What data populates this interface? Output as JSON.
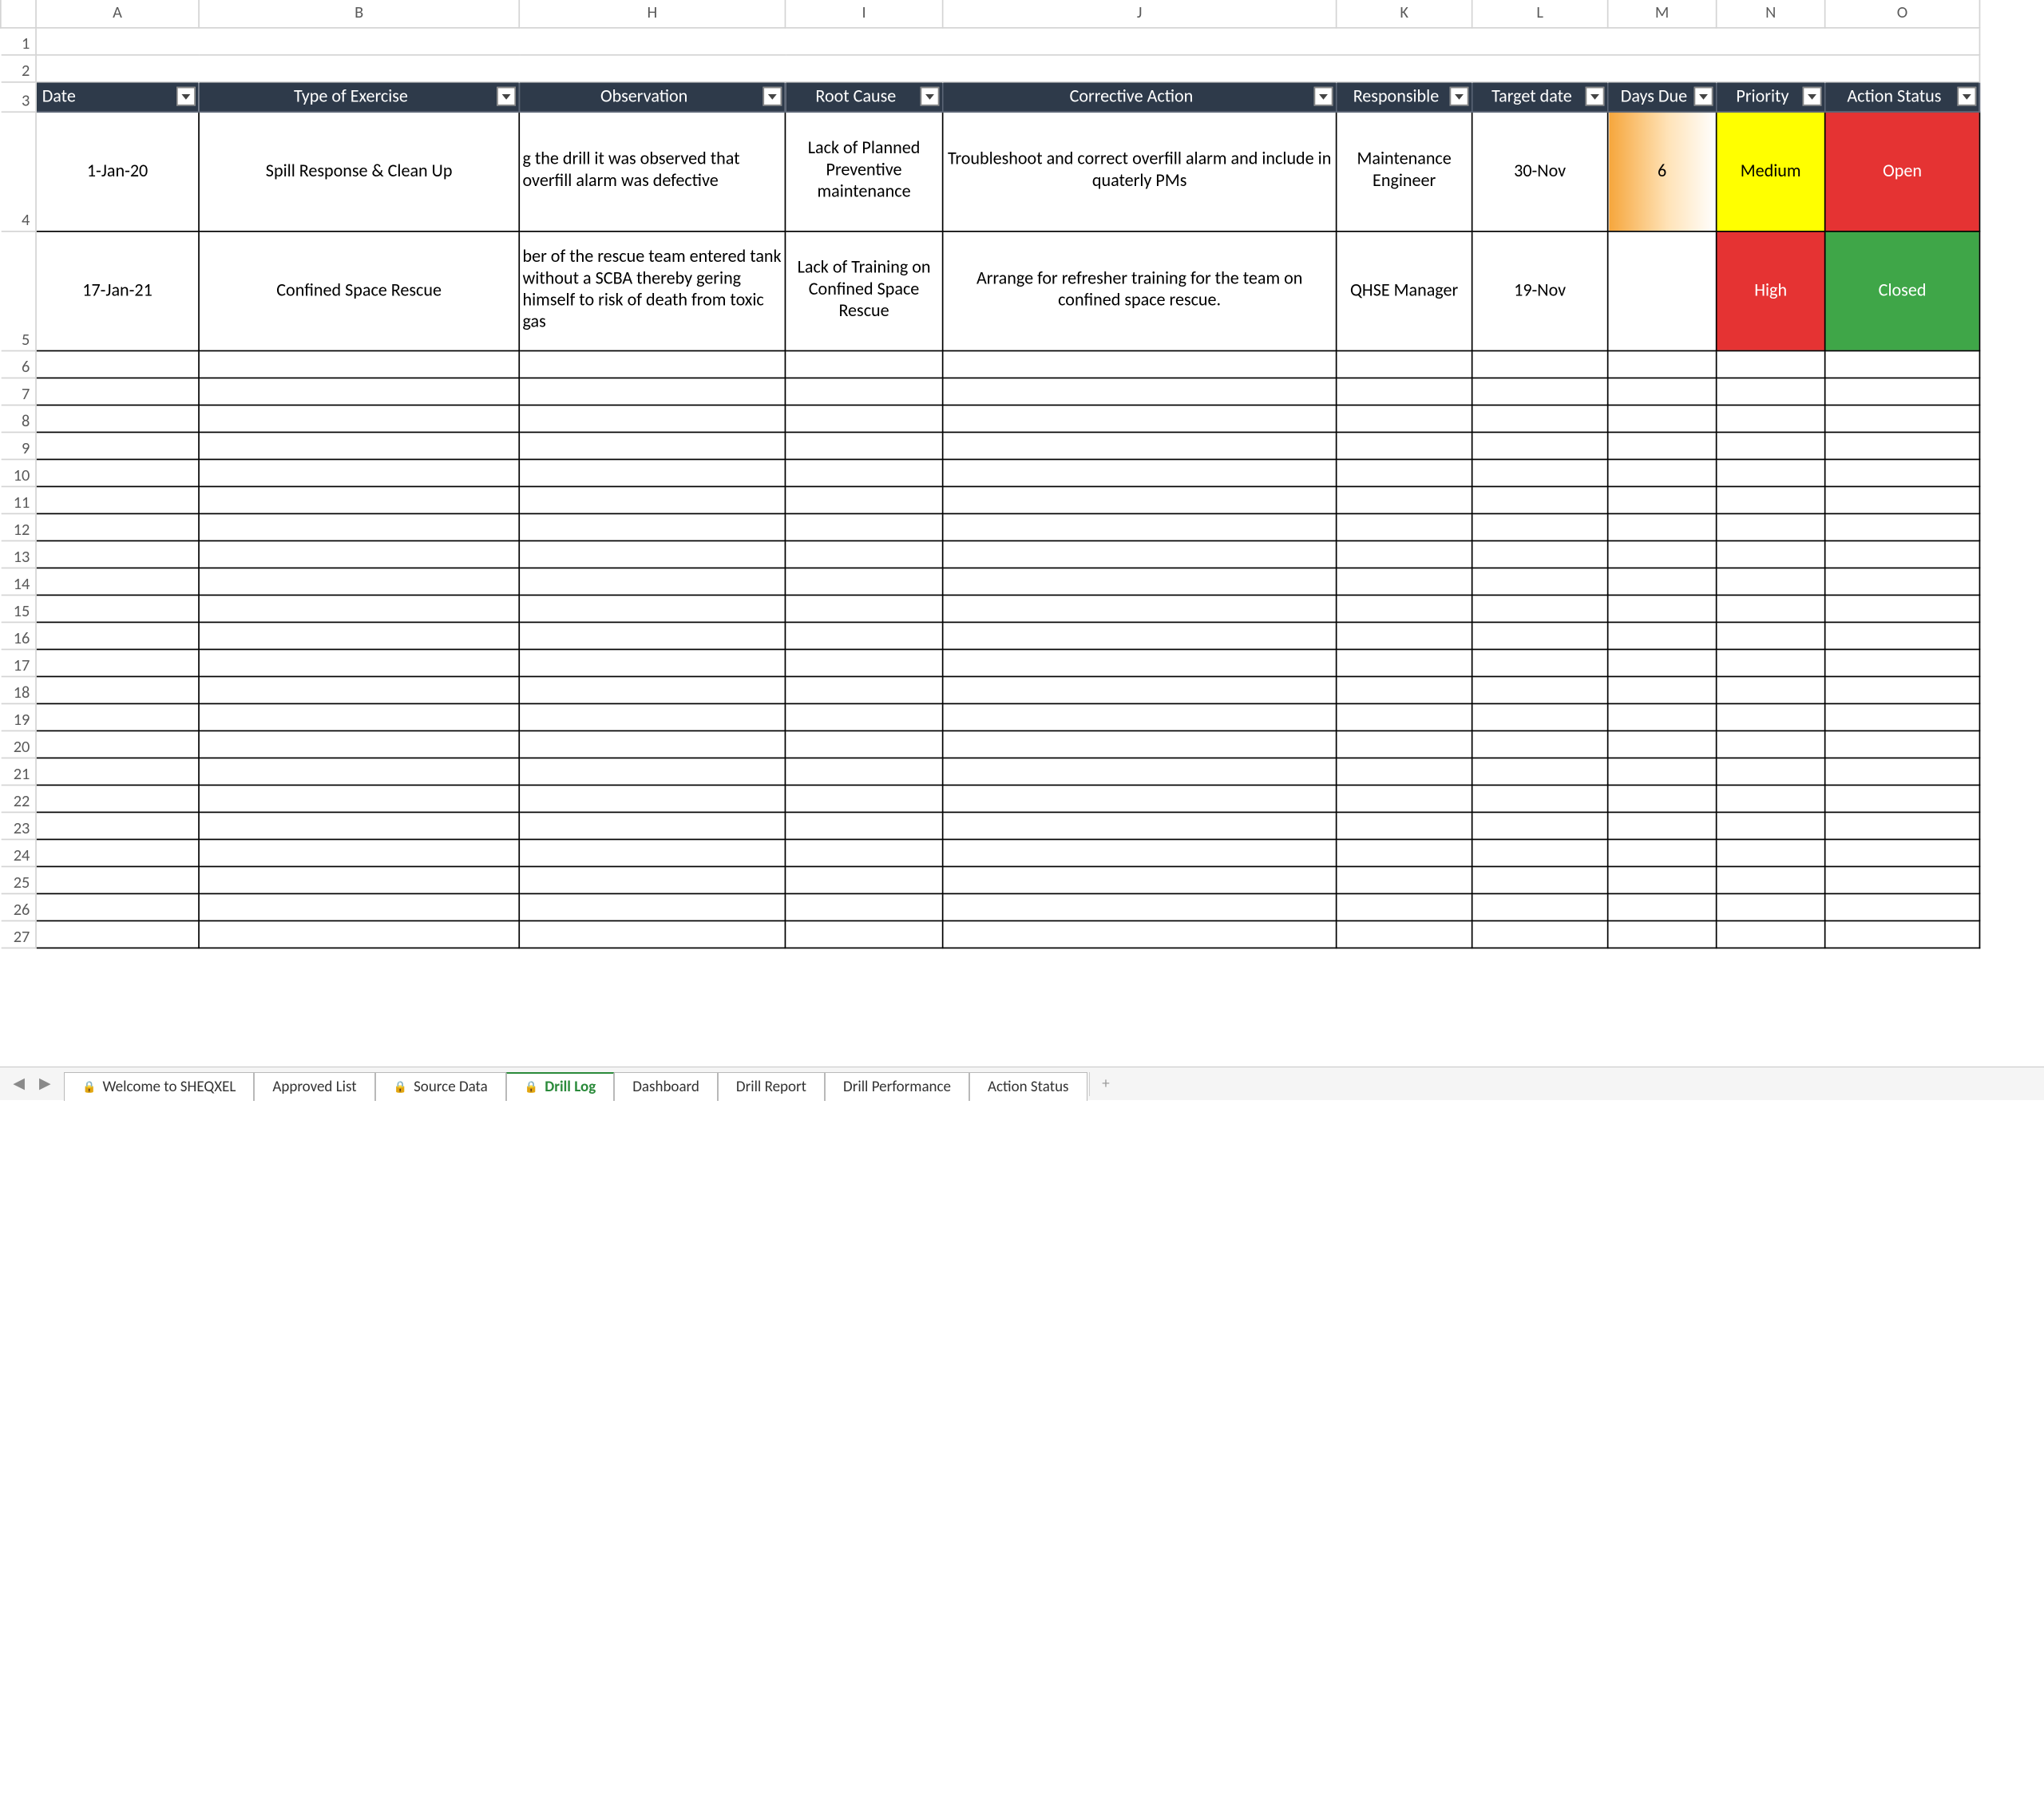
{
  "columns": [
    {
      "letter": "",
      "widthPx": 26
    },
    {
      "letter": "A",
      "widthPx": 120
    },
    {
      "letter": "B",
      "widthPx": 236
    },
    {
      "letter": "H",
      "widthPx": 196
    },
    {
      "letter": "I",
      "widthPx": 116
    },
    {
      "letter": "J",
      "widthPx": 290
    },
    {
      "letter": "K",
      "widthPx": 100
    },
    {
      "letter": "L",
      "widthPx": 100
    },
    {
      "letter": "M",
      "widthPx": 80
    },
    {
      "letter": "N",
      "widthPx": 80
    },
    {
      "letter": "O",
      "widthPx": 114
    }
  ],
  "row_numbers": [
    "1",
    "2",
    "3",
    "4",
    "5",
    "6",
    "7",
    "8",
    "9",
    "10",
    "11",
    "12",
    "13",
    "14",
    "15",
    "16",
    "17",
    "18",
    "19",
    "20",
    "21",
    "22",
    "23",
    "24",
    "25",
    "26",
    "27"
  ],
  "headers": {
    "date": "Date",
    "type": "Type of Exercise",
    "observation": "Observation",
    "root_cause": "Root Cause",
    "corrective": "Corrective Action",
    "responsible": "Responsible",
    "target": "Target date",
    "days_due": "Days Due",
    "priority": "Priority",
    "status": "Action Status"
  },
  "rows": [
    {
      "date": "1-Jan-20",
      "type": "Spill Response & Clean Up",
      "observation": "g the drill it was observed that overfill alarm was defective",
      "root_cause": "Lack of Planned Preventive maintenance",
      "corrective": "Troubleshoot and correct overfill alarm and include in quaterly PMs",
      "responsible": "Maintenance Engineer",
      "target": "30-Nov",
      "days_due": "6",
      "priority": "Medium",
      "status": "Open"
    },
    {
      "date": "17-Jan-21",
      "type": "Confined Space Rescue",
      "observation": "ber of the rescue team entered tank without a SCBA thereby gering himself to risk of death from toxic gas",
      "root_cause": "Lack of Training on Confined Space Rescue",
      "corrective": "Arrange for refresher training for the team on confined space rescue.",
      "responsible": "QHSE Manager",
      "target": "19-Nov",
      "days_due": "",
      "priority": "High",
      "status": "Closed"
    }
  ],
  "tabs": [
    {
      "label": "Welcome to SHEQXEL",
      "locked": true,
      "active": false
    },
    {
      "label": "Approved List",
      "locked": false,
      "active": false
    },
    {
      "label": "Source Data",
      "locked": true,
      "active": false
    },
    {
      "label": "Drill Log",
      "locked": true,
      "active": true
    },
    {
      "label": "Dashboard",
      "locked": false,
      "active": false
    },
    {
      "label": "Drill Report",
      "locked": false,
      "active": false
    },
    {
      "label": "Drill Performance",
      "locked": false,
      "active": false
    },
    {
      "label": "Action Status",
      "locked": false,
      "active": false
    }
  ],
  "nav": {
    "prev": "◀",
    "next": "▶",
    "plus": "+"
  }
}
